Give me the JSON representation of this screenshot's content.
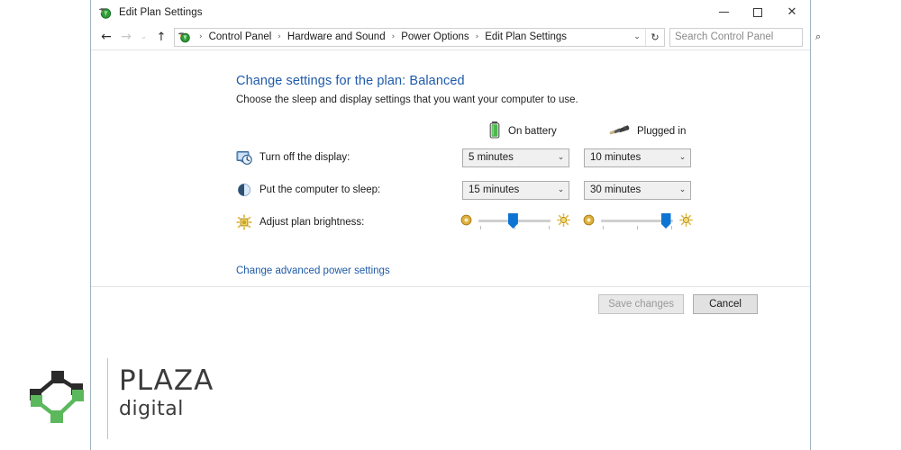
{
  "window": {
    "title": "Edit Plan Settings",
    "app_icon": "power-plan-icon",
    "controls": {
      "minimize": "–",
      "maximize": "□",
      "close": "✕"
    }
  },
  "navbar": {
    "back_icon": "back-arrow-icon",
    "forward_icon": "forward-arrow-icon",
    "history_icon": "chevron-down-icon",
    "up_icon": "up-arrow-icon",
    "breadcrumbs": [
      {
        "label": "Control Panel"
      },
      {
        "label": "Hardware and Sound"
      },
      {
        "label": "Power Options"
      },
      {
        "label": "Edit Plan Settings"
      }
    ],
    "separator": "›",
    "address_chevron": "chevron-down-icon",
    "refresh_icon": "↻",
    "search": {
      "placeholder": "Search Control Panel",
      "value": "",
      "icon": "search-icon"
    }
  },
  "main": {
    "title": "Change settings for the plan: Balanced",
    "subtitle": "Choose the sleep and display settings that you want your computer to use.",
    "columns": [
      {
        "key": "battery",
        "label": "On battery",
        "icon": "battery-icon"
      },
      {
        "key": "plugged",
        "label": "Plugged in",
        "icon": "power-plug-icon"
      }
    ],
    "settings": [
      {
        "icon": "display-icon",
        "label": "Turn off the display:",
        "battery_value": "5 minutes",
        "plugged_value": "10 minutes",
        "chevron": "chevron-down-icon"
      },
      {
        "icon": "sleep-moon-icon",
        "label": "Put the computer to sleep:",
        "battery_value": "15 minutes",
        "plugged_value": "30 minutes",
        "chevron": "chevron-down-icon"
      }
    ],
    "brightness": {
      "icon": "brightness-icon",
      "label": "Adjust plan brightness:",
      "low_icon": "brightness-low-icon",
      "high_icon": "brightness-high-icon",
      "battery_percent": 48,
      "plugged_percent": 90
    },
    "advanced_link": "Change advanced power settings"
  },
  "footer": {
    "save_label": "Save changes",
    "save_disabled": true,
    "cancel_label": "Cancel"
  },
  "logo": {
    "primary": "PLAZA",
    "secondary": "digital",
    "mark": "node-graph-diamond-icon",
    "colors": {
      "dark": "#2b2b2b",
      "green": "#5cb85c"
    }
  },
  "colors": {
    "accent_link": "#1e5aa8",
    "window_border": "#9fb2bd",
    "slider_thumb": "#0e74d4",
    "battery_green": "#49b749"
  }
}
